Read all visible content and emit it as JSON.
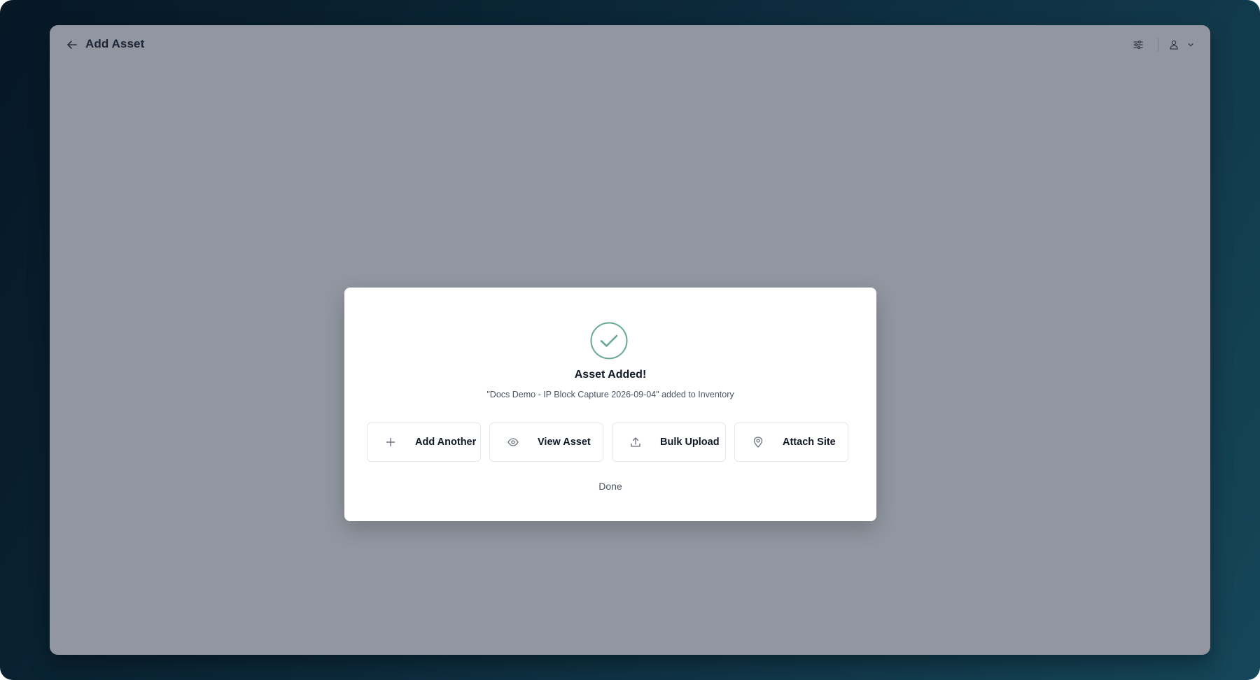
{
  "header": {
    "title": "Add Asset",
    "back_icon": "arrow-left-icon",
    "settings_icon": "sliders-icon",
    "user_icon": "user-icon",
    "user_menu_icon": "chevron-down-icon"
  },
  "modal": {
    "icon": "check-circle-icon",
    "title": "Asset Added!",
    "subtitle": "\"Docs Demo - IP Block Capture 2026-09-04\" added to Inventory",
    "actions": [
      {
        "label": "Add Another",
        "icon": "plus-icon"
      },
      {
        "label": "View Asset",
        "icon": "eye-icon"
      },
      {
        "label": "Bulk Upload",
        "icon": "upload-icon"
      },
      {
        "label": "Attach Site",
        "icon": "map-pin-icon"
      }
    ],
    "done_label": "Done"
  },
  "colors": {
    "success": "#6aa892",
    "overlay": "rgba(26,36,56,0.48)",
    "background_dark": "#061726",
    "background_light": "#154659"
  }
}
